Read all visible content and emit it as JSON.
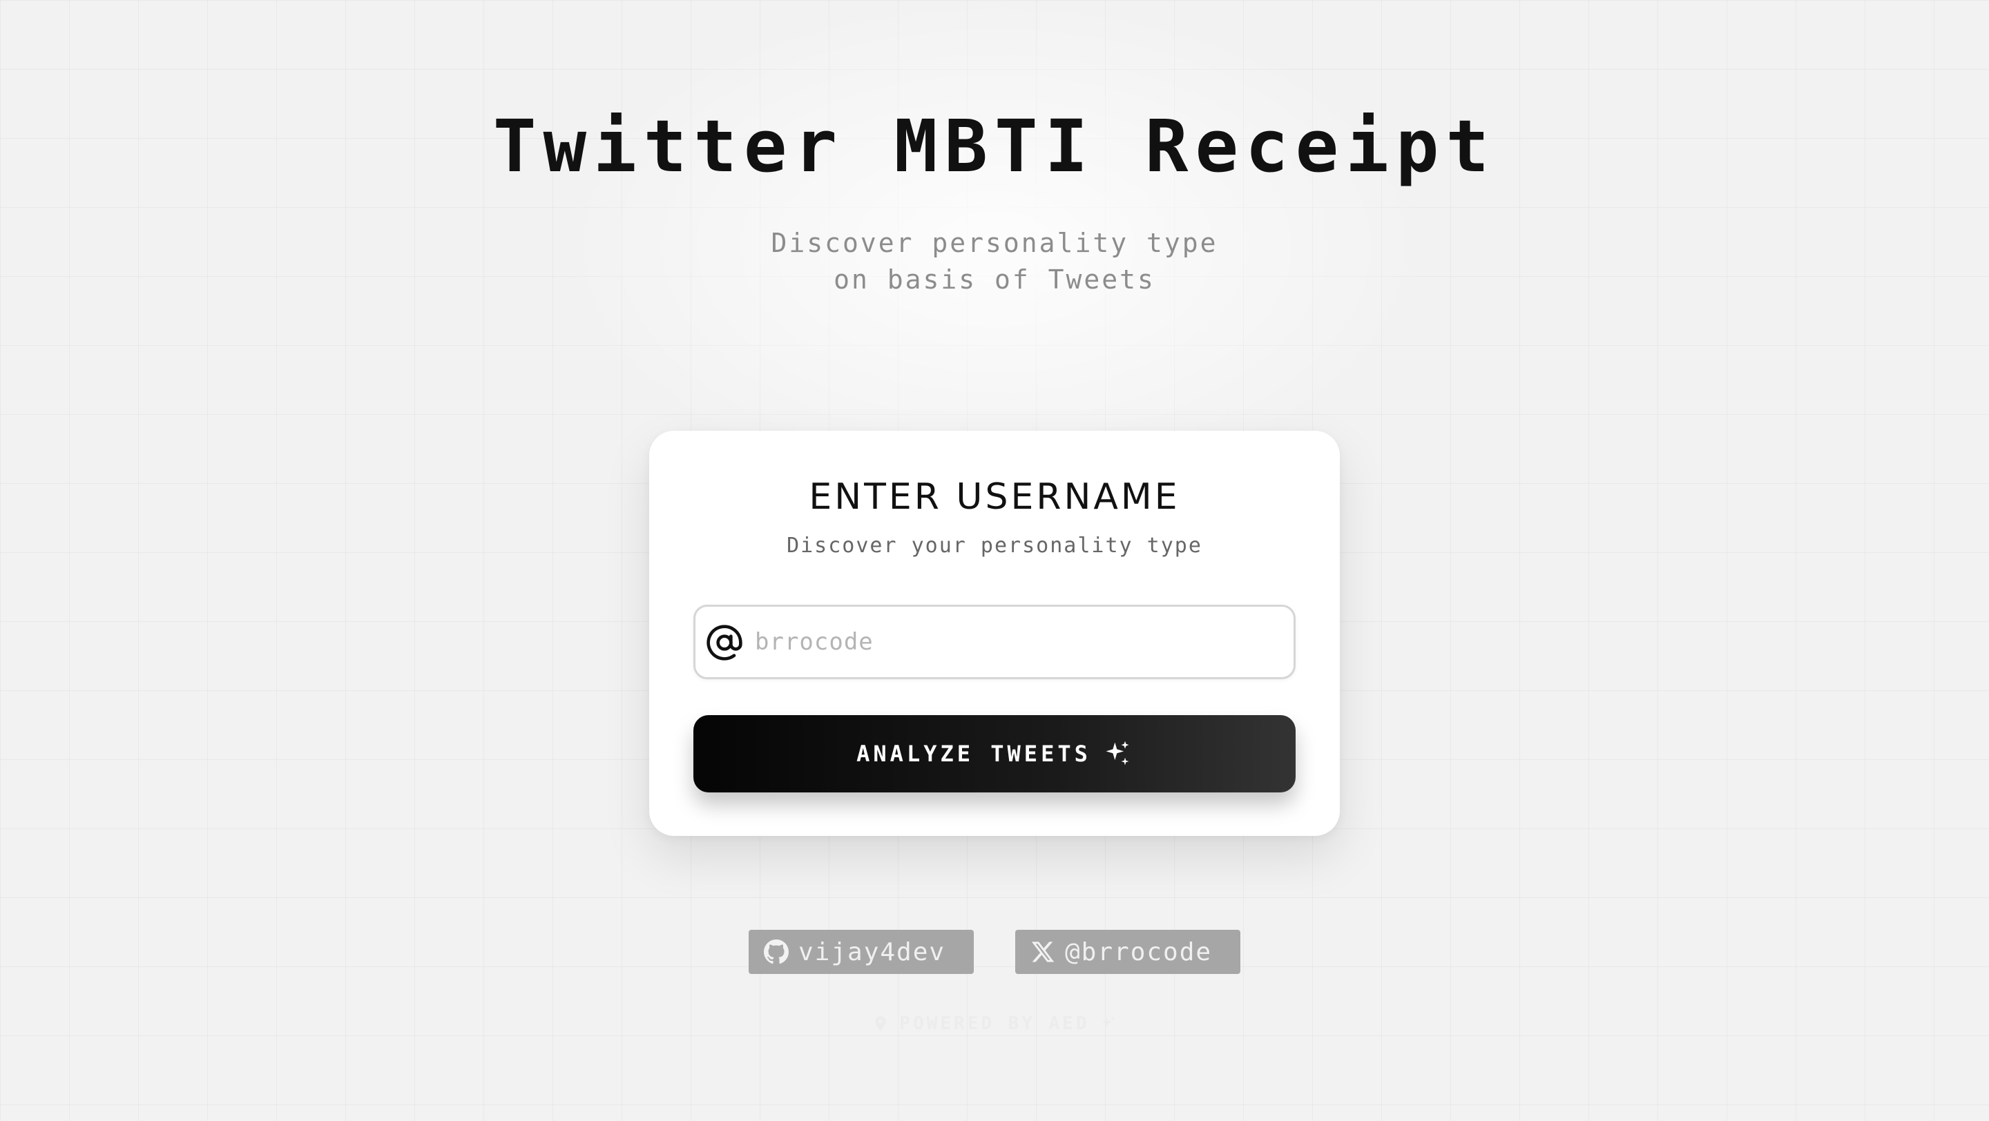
{
  "header": {
    "title": "Twitter MBTI Receipt",
    "subtitle_line1": "Discover personality type",
    "subtitle_line2": "on basis of Tweets"
  },
  "card": {
    "heading": "ENTER USERNAME",
    "subheading": "Discover your personality type",
    "input": {
      "value": "",
      "placeholder": "brrocode",
      "icon": "at-sign-icon"
    },
    "button": {
      "label": "ANALYZE TWEETS",
      "icon": "sparkles-icon"
    }
  },
  "footer": {
    "links": [
      {
        "label": "vijay4dev",
        "icon": "github-icon"
      },
      {
        "label": "@brrocode",
        "icon": "x-logo-icon"
      }
    ],
    "powered_by": "POWERED BY AED"
  },
  "colors": {
    "background": "#f2f2f2",
    "card": "#ffffff",
    "button_start": "#050505",
    "button_end": "#333333",
    "social_badge": "#a6a6a6",
    "subtitle_text": "#8c8c8c"
  }
}
